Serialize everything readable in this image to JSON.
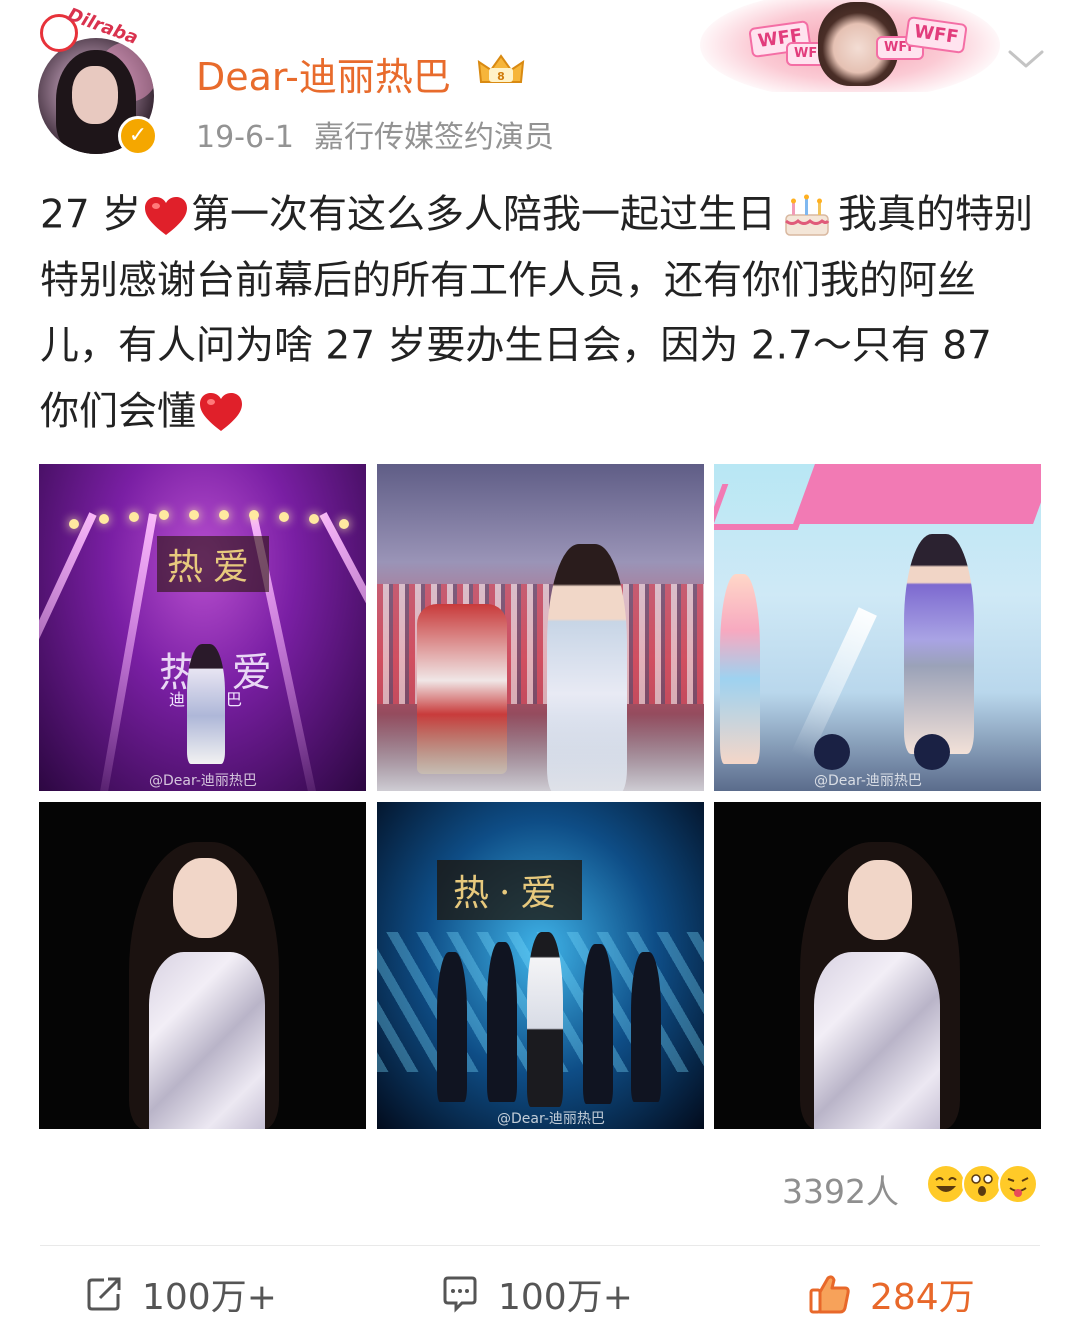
{
  "post": {
    "author": "Dear-迪丽热巴",
    "avatar_tag": "Dilraba",
    "date": "19-6-1",
    "source": "嘉行传媒签约演员",
    "banner_tags": [
      "WFF",
      "WFF",
      "WFF",
      "WFF"
    ],
    "text": {
      "p1": "27 岁",
      "p2": "第一次有这么多人陪我一起过生日",
      "p3": "我真的特别特别感谢台前幕后的所有工作人员，还有你们我的阿丝儿，有人问为啥 27 岁要办生日会，因为 2.7～只有 87 你们会懂"
    },
    "photos": [
      {
        "sign": "热爱",
        "sign2": "热 爱",
        "caption": "迪丽热巴",
        "watermark": "@Dear-迪丽热巴"
      },
      {
        "watermark": ""
      },
      {
        "watermark": "@Dear-迪丽热巴"
      },
      {},
      {
        "sign": "热·爱",
        "watermark": "@Dear-迪丽热巴"
      },
      {}
    ]
  },
  "footer": {
    "reactions": "3392人",
    "repost": "100万+",
    "comment": "100万+",
    "like": "284万"
  },
  "icons": [
    "heart-icon",
    "birthday-cake-icon",
    "member-crown-icon",
    "verified-icon",
    "chevron-down-icon",
    "repost-icon",
    "comment-icon",
    "thumbs-up-icon"
  ],
  "colors": {
    "accent": "#e86b2c",
    "text": "#222222",
    "muted": "#939393",
    "verified": "#f5a700"
  }
}
